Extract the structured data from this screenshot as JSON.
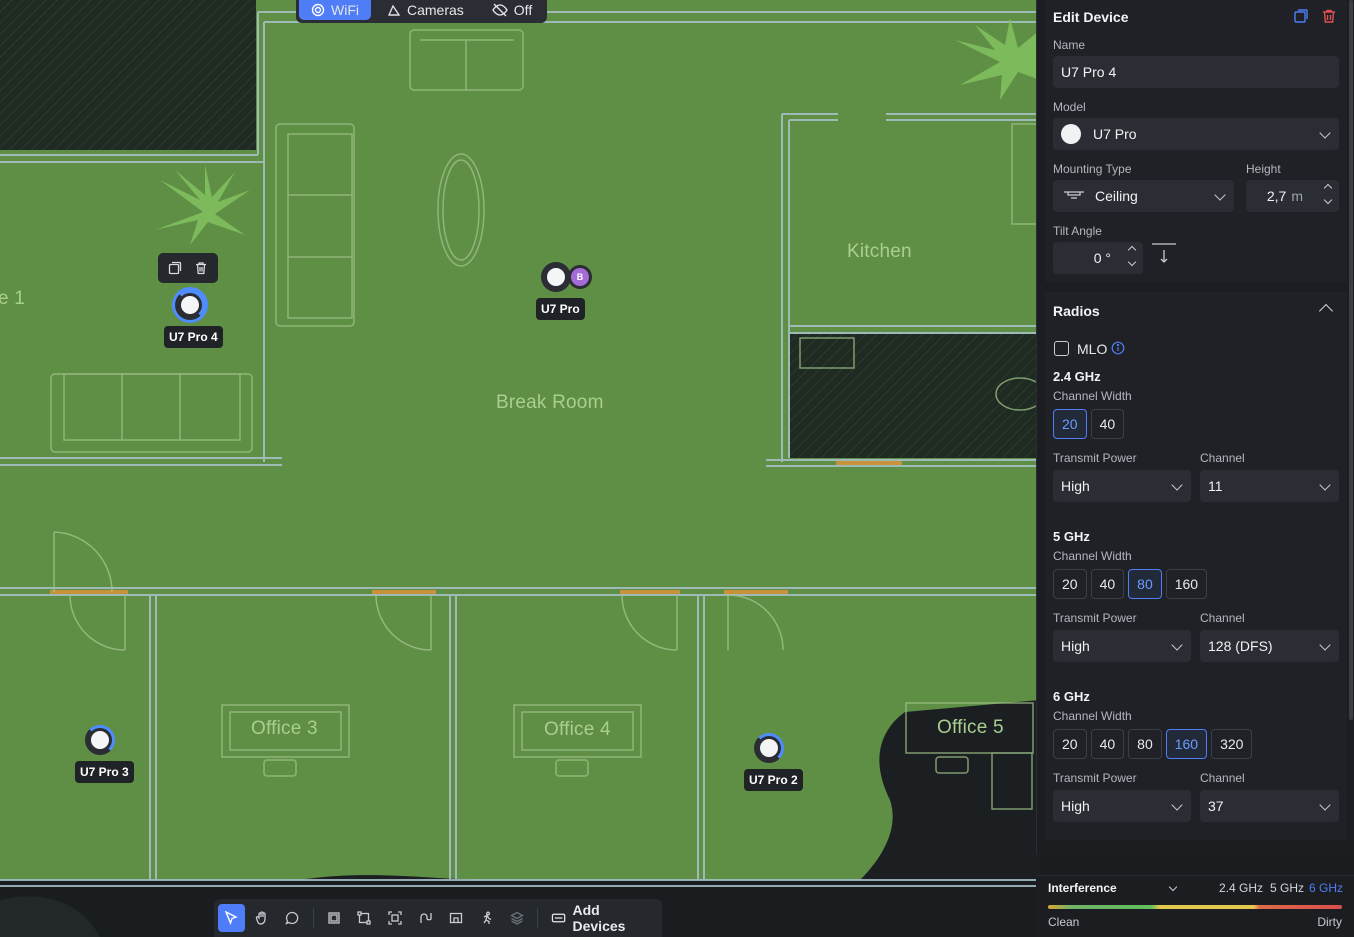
{
  "mode_bar": {
    "wifi": "WiFi",
    "cameras": "Cameras",
    "off": "Off"
  },
  "rooms": {
    "room1": "e 1",
    "break_room": "Break Room",
    "kitchen": "Kitchen",
    "office3": "Office 3",
    "office4": "Office 4",
    "office5": "Office 5"
  },
  "devices": {
    "d1": "U7 Pro 4",
    "d2": "U7 Pro",
    "d3": "U7 Pro 3",
    "d4": "U7 Pro 2",
    "badge": "B"
  },
  "bottom_toolbar": {
    "add_devices": "Add Devices"
  },
  "edit_device": {
    "title": "Edit Device",
    "name_label": "Name",
    "name_value": "U7 Pro 4",
    "model_label": "Model",
    "model_value": "U7 Pro",
    "mounting_label": "Mounting Type",
    "mounting_value": "Ceiling",
    "height_label": "Height",
    "height_value": "2,7",
    "height_unit": "m",
    "tilt_label": "Tilt Angle",
    "tilt_value": "0 °"
  },
  "radios": {
    "title": "Radios",
    "mlo_label": "MLO",
    "band24": {
      "title": "2.4 GHz",
      "width_label": "Channel Width",
      "widths": [
        "20",
        "40"
      ],
      "power_label": "Transmit Power",
      "power_value": "High",
      "channel_label": "Channel",
      "channel_value": "11"
    },
    "band5": {
      "title": "5 GHz",
      "width_label": "Channel Width",
      "widths": [
        "20",
        "40",
        "80",
        "160"
      ],
      "power_label": "Transmit Power",
      "power_value": "High",
      "channel_label": "Channel",
      "channel_value": "128 (DFS)"
    },
    "band6": {
      "title": "6 GHz",
      "width_label": "Channel Width",
      "widths": [
        "20",
        "40",
        "80",
        "160",
        "320"
      ],
      "power_label": "Transmit Power",
      "power_value": "High",
      "channel_label": "Channel",
      "channel_value": "37"
    }
  },
  "interference": {
    "title": "Interference",
    "tab24": "2.4 GHz",
    "tab5": "5 GHz",
    "tab6": "6 GHz",
    "clean": "Clean",
    "dirty": "Dirty"
  },
  "colors": {
    "floor": "#5f8e45",
    "accent": "#4f7df7",
    "panel": "#1f2126"
  }
}
